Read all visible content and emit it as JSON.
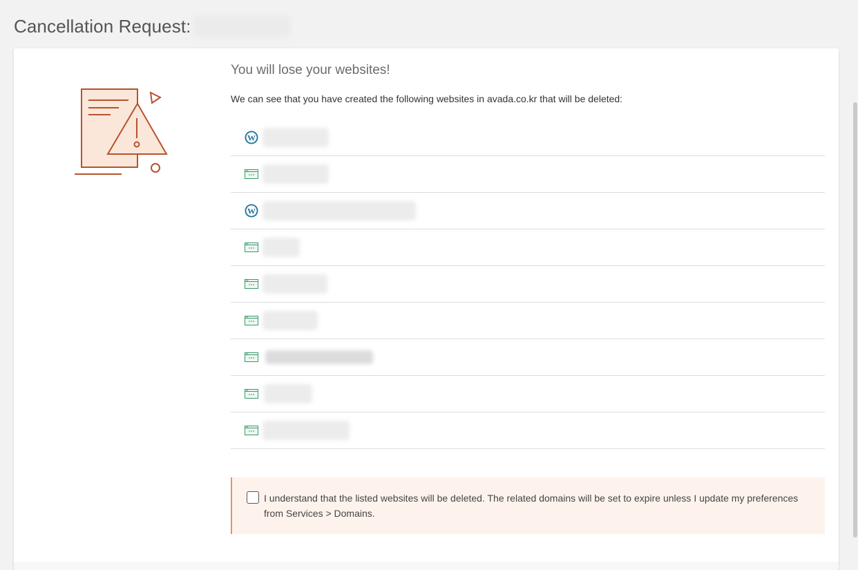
{
  "page": {
    "title": "Cancellation Request:"
  },
  "warning": {
    "heading": "You will lose your websites!",
    "intro": "We can see that you have created the following websites in avada.co.kr that will be deleted:"
  },
  "websites": [
    {
      "icon": "wordpress-icon"
    },
    {
      "icon": "website-icon"
    },
    {
      "icon": "wordpress-icon"
    },
    {
      "icon": "website-icon"
    },
    {
      "icon": "website-icon"
    },
    {
      "icon": "website-icon"
    },
    {
      "icon": "website-icon"
    },
    {
      "icon": "website-icon"
    },
    {
      "icon": "website-icon"
    }
  ],
  "acknowledgement": {
    "checked": false,
    "line1": "I understand that the listed websites will be deleted. The related domains will be set to expire unless I update my preferences",
    "line2": "from Services > Domains."
  },
  "colors": {
    "accent": "#b5532a",
    "ack_background": "#fdf3ec",
    "ack_border": "#e1946a",
    "wordpress_blue": "#21759b",
    "site_icon_green": "#3a9a6a"
  }
}
